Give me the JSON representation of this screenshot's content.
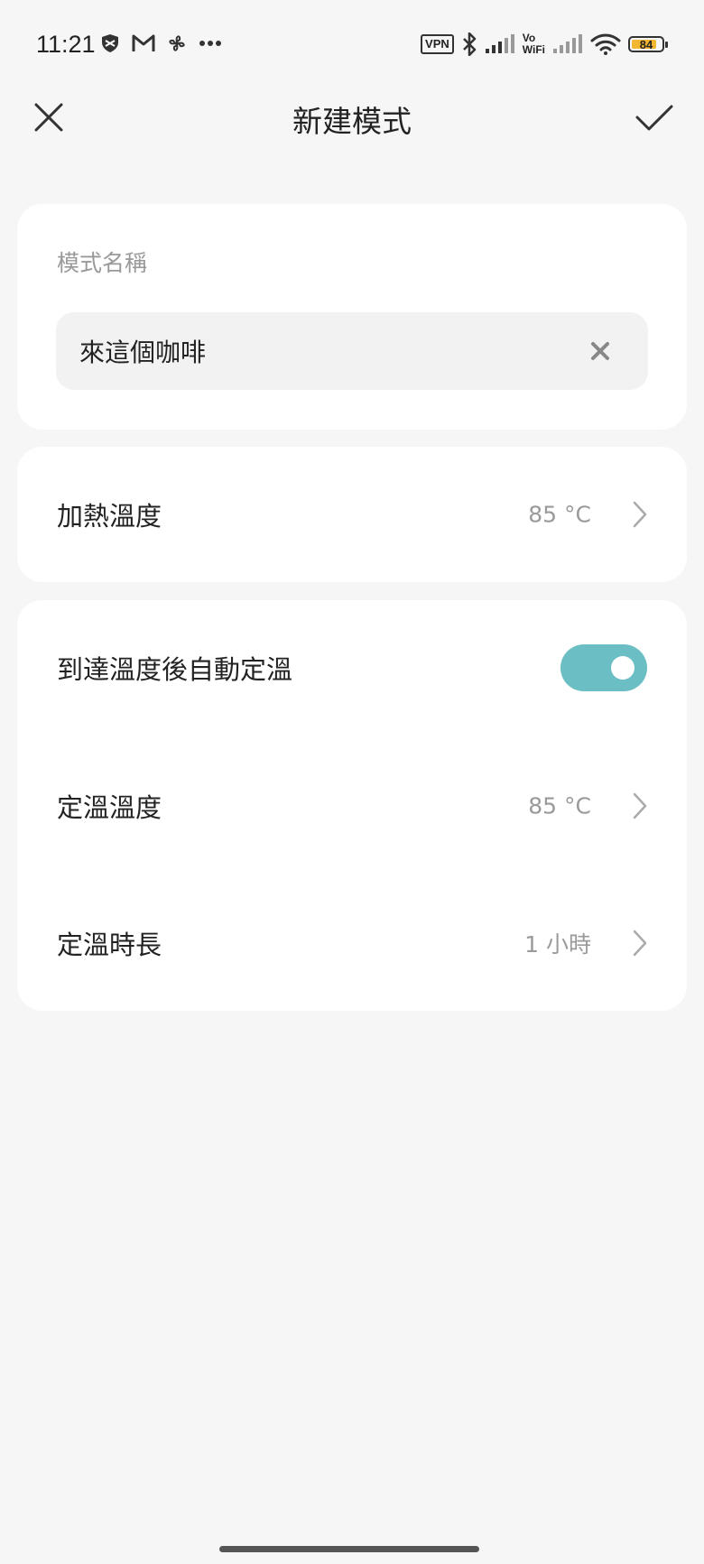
{
  "status_bar": {
    "time": "11:21",
    "left_icons": [
      "shield-icon",
      "gmail-icon",
      "fan-icon",
      "more-dots-icon"
    ],
    "vpn_label": "VPN",
    "vowifi_top": "Vo",
    "vowifi_bottom": "WiFi",
    "battery_level": "84",
    "battery_fraction": 0.84,
    "battery_color": "#f2b630"
  },
  "title_bar": {
    "title": "新建模式"
  },
  "name_section": {
    "label": "模式名稱",
    "value": "來這個咖啡"
  },
  "heat_section": {
    "label": "加熱溫度",
    "value": "85 °C"
  },
  "keep_warm_section": {
    "auto_keep_label": "到達溫度後自動定溫",
    "auto_keep_enabled": true,
    "toggle_color": "#6bbec4",
    "keep_temp_label": "定溫溫度",
    "keep_temp_value": "85 °C",
    "keep_duration_label": "定溫時長",
    "keep_duration_value": "1 小時"
  }
}
